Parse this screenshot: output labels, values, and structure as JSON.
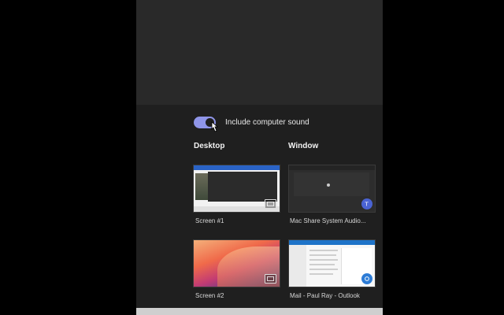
{
  "share": {
    "include_sound": {
      "label": "Include computer sound",
      "enabled": true
    },
    "desktop": {
      "heading": "Desktop",
      "screens": [
        {
          "label": "Screen #1",
          "icon": "monitor-icon"
        },
        {
          "label": "Screen #2",
          "icon": "monitor-icon"
        }
      ]
    },
    "window": {
      "heading": "Window",
      "windows": [
        {
          "label": "Mac Share System Audio...",
          "icon": "teams-icon"
        },
        {
          "label": "Mail - Paul Ray - Outlook",
          "icon": "outlook-icon"
        }
      ]
    }
  },
  "colors": {
    "toggle_on": "#8f95e8",
    "panel_bg": "#1f1f1f",
    "top_bg": "#292929"
  }
}
